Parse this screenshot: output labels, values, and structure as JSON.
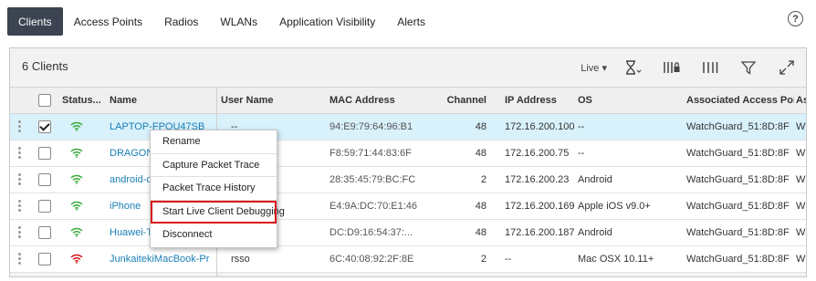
{
  "nav": {
    "tabs": [
      "Clients",
      "Access Points",
      "Radios",
      "WLANs",
      "Application Visibility",
      "Alerts"
    ],
    "active": "Clients",
    "help": "?"
  },
  "panel": {
    "title": "6 Clients",
    "live_label": "Live ▾"
  },
  "table": {
    "columns": [
      "Status...",
      "Name",
      "User Name",
      "MAC Address",
      "Channel",
      "IP Address",
      "OS",
      "Associated Access Poi...",
      "As"
    ],
    "rows": [
      {
        "name": "LAPTOP-FPQU47SB",
        "user": "--",
        "mac": "94:E9:79:64:96:B1",
        "channel": "48",
        "ip": "172.16.200.100",
        "os": "--",
        "ap": "WatchGuard_51:8D:8F",
        "extra": "W",
        "status": "green",
        "checked": true
      },
      {
        "name": "DRAGON",
        "user": "",
        "mac": "F8:59:71:44:83:6F",
        "channel": "48",
        "ip": "172.16.200.75",
        "os": "--",
        "ap": "WatchGuard_51:8D:8F",
        "extra": "W",
        "status": "green",
        "checked": false
      },
      {
        "name": "android-c",
        "user": "",
        "mac": "28:35:45:79:BC:FC",
        "channel": "2",
        "ip": "172.16.200.23",
        "os": "Android",
        "ap": "WatchGuard_51:8D:8F",
        "extra": "W",
        "status": "green",
        "checked": false
      },
      {
        "name": "iPhone",
        "user": "",
        "mac": "E4:9A:DC:70:E1:46",
        "channel": "48",
        "ip": "172.16.200.169",
        "os": "Apple iOS v9.0+",
        "ap": "WatchGuard_51:8D:8F",
        "extra": "W",
        "status": "green",
        "checked": false
      },
      {
        "name": "Huawei-T",
        "user": "",
        "mac": "DC:D9:16:54:37:...",
        "channel": "48",
        "ip": "172.16.200.187",
        "os": "Android",
        "ap": "WatchGuard_51:8D:8F",
        "extra": "W",
        "status": "green",
        "checked": false
      },
      {
        "name": "JunkaitekiMacBook-Pr",
        "user": "rsso",
        "mac": "6C:40:08:92:2F:8E",
        "channel": "2",
        "ip": "--",
        "os": "Mac OSX 10.11+",
        "ap": "WatchGuard_51:8D:8F",
        "extra": "W",
        "status": "red",
        "checked": false
      }
    ]
  },
  "context_menu": {
    "items": [
      "Rename",
      "Capture Packet Trace",
      "Packet Trace History",
      "Start Live Client Debugging",
      "Disconnect"
    ],
    "highlighted": "Start Live Client Debugging"
  },
  "colors": {
    "active_tab": "#3b4450",
    "link": "#1a7fb5",
    "wifi_ok": "#3cab3c",
    "wifi_bad": "#d9141b",
    "highlight": "#d9141b",
    "selected_row": "#d8f1fb"
  },
  "icons": [
    "help-icon",
    "hourglass-icon",
    "columns-lock-icon",
    "columns-icon",
    "filter-icon",
    "expand-icon",
    "wifi-icon",
    "drag-handle-icon"
  ]
}
